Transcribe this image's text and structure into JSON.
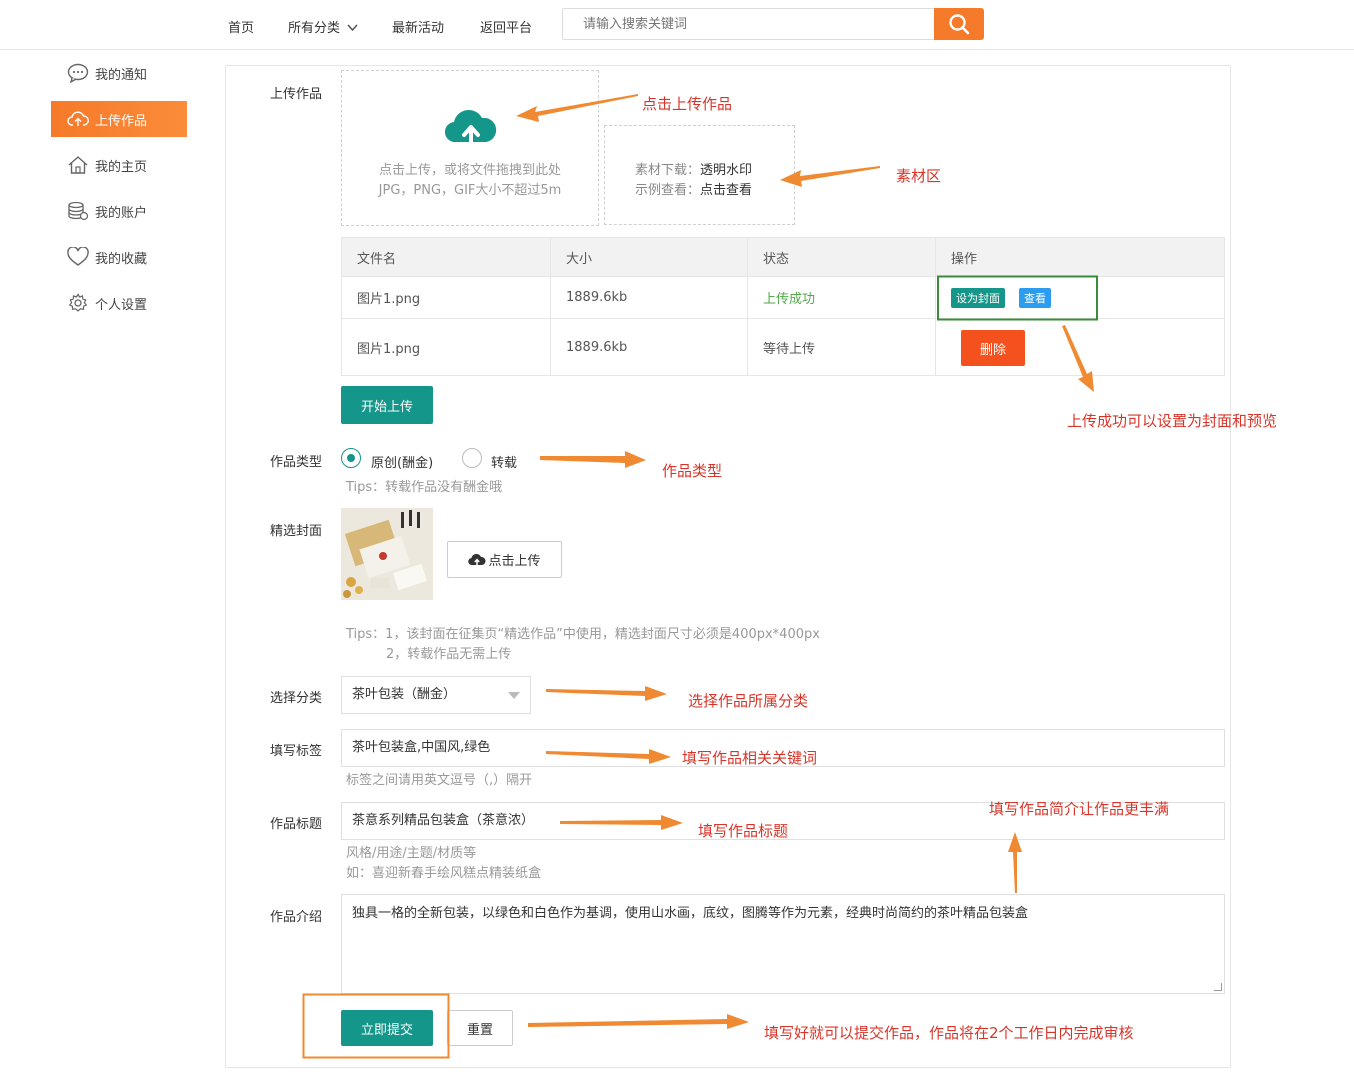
{
  "nav": {
    "home": "首页",
    "categories": "所有分类",
    "events": "最新活动",
    "back": "返回平台",
    "search_placeholder": "请输入搜索关键词"
  },
  "sidebar": {
    "items": [
      {
        "label": "我的通知",
        "icon": "chat-icon"
      },
      {
        "label": "上传作品",
        "icon": "cloud-upload-icon",
        "active": true
      },
      {
        "label": "我的主页",
        "icon": "home-icon"
      },
      {
        "label": "我的账户",
        "icon": "database-icon"
      },
      {
        "label": "我的收藏",
        "icon": "heart-icon"
      },
      {
        "label": "个人设置",
        "icon": "gear-icon"
      }
    ]
  },
  "upload": {
    "label": "上传作品",
    "hint1": "点击上传，或将文件拖拽到此处",
    "hint2": "JPG，PNG，GIF大小不超过5m",
    "material_label1": "素材下载：",
    "material_link1": "透明水印",
    "material_label2": "示例查看：",
    "material_link2": "点击查看"
  },
  "table": {
    "headers": [
      "文件名",
      "大小",
      "状态",
      "操作"
    ],
    "rows": [
      {
        "name": "图片1.png",
        "size": "1889.6kb",
        "status": "上传成功"
      },
      {
        "name": "图片1.png",
        "size": "1889.6kb",
        "status": "等待上传"
      }
    ],
    "set_cover": "设为封面",
    "view": "查看",
    "delete": "删除"
  },
  "start_upload": "开始上传",
  "type": {
    "label": "作品类型",
    "original": "原创(酬金)",
    "repost": "转载",
    "tip": "Tips：转载作品没有酬金哦"
  },
  "cover": {
    "label": "精选封面",
    "upload_btn": "点击上传",
    "tip1": "Tips：1，该封面在征集页“精选作品”中使用，精选封面尺寸必须是400px*400px",
    "tip2": "2，转载作品无需上传"
  },
  "category": {
    "label": "选择分类",
    "value": "茶叶包装（酬金）"
  },
  "tags": {
    "label": "填写标签",
    "value": "茶叶包装盒,中国风,绿色",
    "tip": "标签之间请用英文逗号（,）隔开"
  },
  "title": {
    "label": "作品标题",
    "value": "茶意系列精品包装盒（茶意浓）",
    "tip1": "风格/用途/主题/材质等",
    "tip2": "如：喜迎新春手绘风糕点精装纸盒"
  },
  "intro": {
    "label": "作品介绍",
    "value": "独具一格的全新包装，以绿色和白色作为基调，使用山水画，底纹，图腾等作为元素，经典时尚简约的茶叶精品包装盒"
  },
  "actions": {
    "submit": "立即提交",
    "reset": "重置"
  },
  "annotations": {
    "upload": "点击上传作品",
    "material": "素材区",
    "cover_preview": "上传成功可以设置为封面和预览",
    "type": "作品类型",
    "category": "选择作品所属分类",
    "tags": "填写作品相关关键词",
    "title": "填写作品标题",
    "intro": "填写作品简介让作品更丰满",
    "submit": "填写好就可以提交作品，作品将在2个工作日内完成审核"
  },
  "colors": {
    "accent_orange": "#f57a2a",
    "primary_teal": "#15968a",
    "danger": "#f4511e",
    "annotation_red": "#d8352a",
    "arrow_orange": "#f08a32"
  }
}
